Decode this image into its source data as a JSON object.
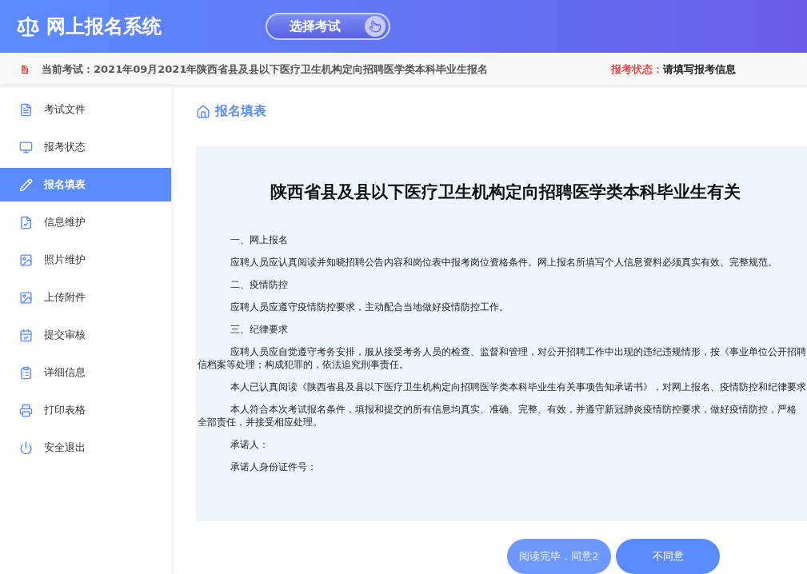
{
  "header": {
    "title": "网上报名系统",
    "exam_button": "选择考试"
  },
  "info_bar": {
    "label": "当前考试：",
    "exam": "2021年09月2021年陕西省县及县以下医疗卫生机构定向招聘医学类本科毕业生报名",
    "status_label": "报考状态：",
    "status": "请填写报考信息"
  },
  "sidebar": {
    "items": [
      {
        "label": "考试文件",
        "selected": false
      },
      {
        "label": "报考状态",
        "selected": false
      },
      {
        "label": "报名填表",
        "selected": true
      },
      {
        "label": "信息维护",
        "selected": false
      },
      {
        "label": "照片维护",
        "selected": false
      },
      {
        "label": "上传附件",
        "selected": false
      },
      {
        "label": "提交审核",
        "selected": false
      },
      {
        "label": "详细信息",
        "selected": false
      },
      {
        "label": "打印表格",
        "selected": false
      },
      {
        "label": "安全退出",
        "selected": false
      }
    ]
  },
  "breadcrumb": "报名填表",
  "document": {
    "title": "陕西省县及县以下医疗卫生机构定向招聘医学类本科毕业生有关",
    "paragraphs": [
      [
        "一、网上报名"
      ],
      [
        "应聘人员应认真阅读并知晓招聘公告内容和岗位表中报考岗位资格条件。网上报名所填写个人信息资料必须真实有效、完整规范。"
      ],
      [
        "二、疫情防控"
      ],
      [
        "应聘人员应遵守疫情防控要求，主动配合当地做好疫情防控工作。"
      ],
      [
        "三、纪律要求"
      ],
      [
        "应聘人员应自觉遵守考务安排，服从接受考务人员的检查、监督和管理，对公开招聘工作中出现的违纪违规情形，按《事业单位公开招聘",
        "信档案等处理；构成犯罪的，依法追究刑事责任。"
      ],
      [
        "本人已认真阅读《陕西省县及县以下医疗卫生机构定向招聘医学类本科毕业生有关事项告知承诺书》，对网上报名、疫情防控和纪律要求"
      ],
      [
        "本人符合本次考试报名条件，填报和提交的所有信息均真实、准确、完整、有效，并遵守新冠肺炎疫情防控要求，做好疫情防控，严格",
        "全部责任，并接受相应处理。"
      ],
      [
        "承诺人："
      ],
      [
        "承诺人身份证件号："
      ]
    ]
  },
  "buttons": [
    {
      "label": "阅读完毕，同意2",
      "disabled": true
    },
    {
      "label": "不同意",
      "disabled": false
    }
  ]
}
